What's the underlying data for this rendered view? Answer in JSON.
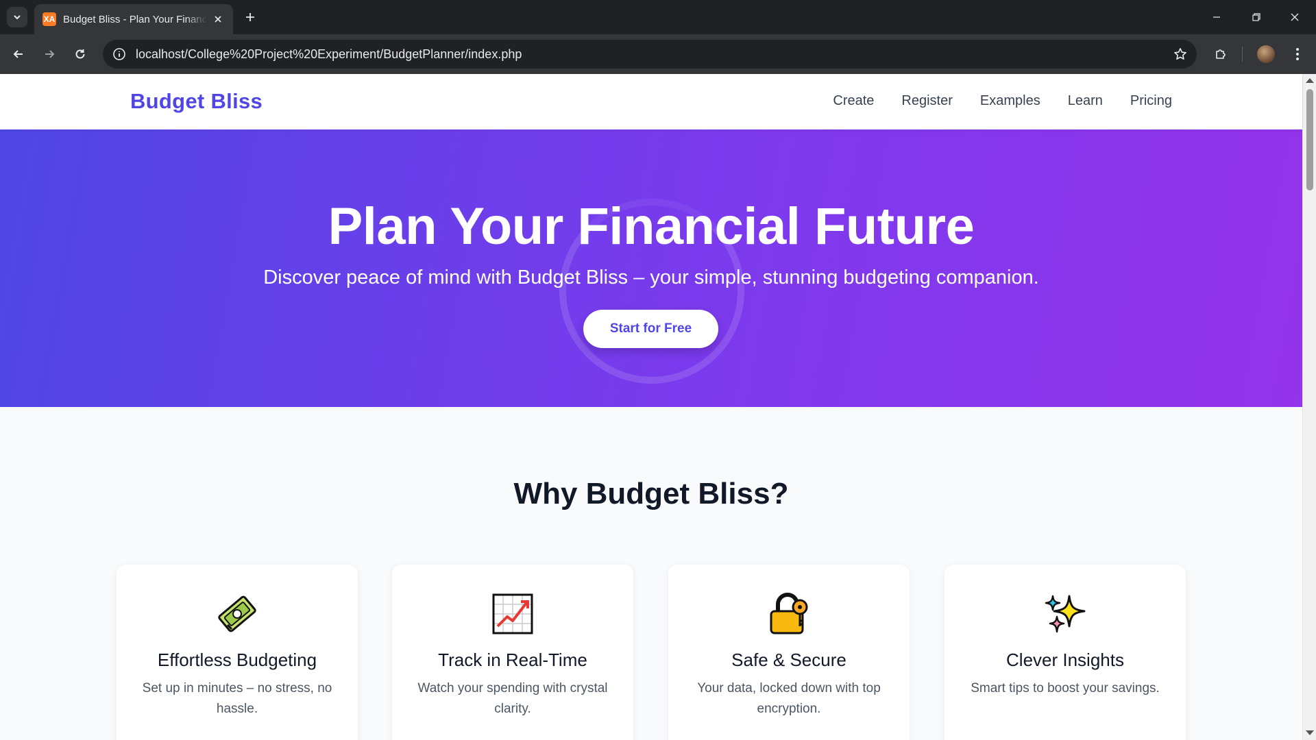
{
  "browser": {
    "tab_title": "Budget Bliss - Plan Your Financial Future",
    "favicon_text": "XA",
    "url": "localhost/College%20Project%20Experiment/BudgetPlanner/index.php"
  },
  "header": {
    "brand": "Budget Bliss",
    "nav": [
      "Create",
      "Register",
      "Examples",
      "Learn",
      "Pricing"
    ]
  },
  "hero": {
    "title": "Plan Your Financial Future",
    "subtitle": "Discover peace of mind with Budget Bliss – your simple, stunning budgeting companion.",
    "cta": "Start for Free"
  },
  "features": {
    "title": "Why Budget Bliss?",
    "items": [
      {
        "icon": "money-icon",
        "title": "Effortless Budgeting",
        "desc": "Set up in minutes – no stress, no hassle."
      },
      {
        "icon": "chart-increasing-icon",
        "title": "Track in Real-Time",
        "desc": "Watch your spending with crystal clarity."
      },
      {
        "icon": "lock-with-key-icon",
        "title": "Safe & Secure",
        "desc": "Your data, locked down with top encryption."
      },
      {
        "icon": "sparkles-icon",
        "title": "Clever Insights",
        "desc": "Smart tips to boost your savings."
      }
    ]
  },
  "colors": {
    "brand": "#4f46e5",
    "hero_start": "#4f46e5",
    "hero_end": "#9333ea"
  }
}
